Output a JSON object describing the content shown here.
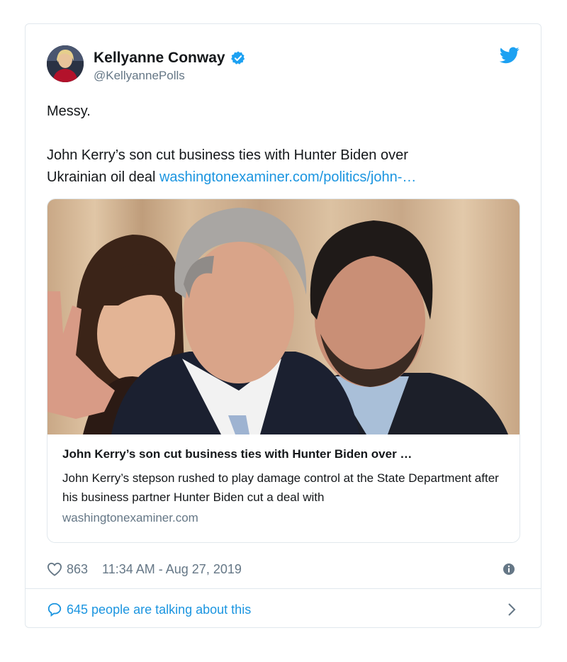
{
  "author": {
    "display_name": "Kellyanne Conway",
    "handle": "@KellyannePolls",
    "verified": true,
    "avatar": "avatar-photo"
  },
  "tweet": {
    "line1": "Messy.",
    "line2": "John Kerry’s son cut business ties with Hunter Biden over",
    "line3_text": "Ukrainian oil deal ",
    "line3_link": "washingtonexaminer.com/politics/john-…"
  },
  "card": {
    "image": "photo of two men in suits, a woman and a raised hand in the background",
    "title": "John Kerry’s son cut business ties with Hunter Biden over …",
    "description": "John Kerry’s stepson rushed to play damage control at the State Department after his business partner Hunter Biden cut a deal with",
    "domain": "washingtonexaminer.com"
  },
  "meta": {
    "likes": "863",
    "timestamp": "11:34 AM - Aug 27, 2019"
  },
  "footer": {
    "talking": "645 people are talking about this"
  },
  "colors": {
    "accent": "#1b95e0",
    "muted": "#657786",
    "border": "#e1e8ed",
    "verified": "#1da1f2"
  },
  "icons": [
    "verified-badge-icon",
    "twitter-bird-icon",
    "heart-icon",
    "info-icon",
    "speech-bubble-icon",
    "chevron-right-icon"
  ]
}
